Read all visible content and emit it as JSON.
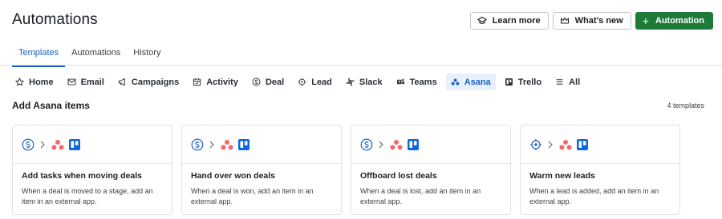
{
  "page": {
    "title": "Automations"
  },
  "header": {
    "learn_more_label": "Learn more",
    "whats_new_label": "What's new",
    "automation_label": "Automation"
  },
  "tabs": [
    {
      "label": "Templates",
      "active": true
    },
    {
      "label": "Automations",
      "active": false
    },
    {
      "label": "History",
      "active": false
    }
  ],
  "filters": [
    {
      "label": "Home",
      "icon": "star-icon"
    },
    {
      "label": "Email",
      "icon": "mail-icon"
    },
    {
      "label": "Campaigns",
      "icon": "megaphone-icon"
    },
    {
      "label": "Activity",
      "icon": "calendar-icon"
    },
    {
      "label": "Deal",
      "icon": "dollar-circle-icon"
    },
    {
      "label": "Lead",
      "icon": "target-icon"
    },
    {
      "label": "Slack",
      "icon": "slack-icon"
    },
    {
      "label": "Teams",
      "icon": "teams-icon"
    },
    {
      "label": "Asana",
      "icon": "asana-icon",
      "active": true
    },
    {
      "label": "Trello",
      "icon": "trello-icon"
    },
    {
      "label": "All",
      "icon": "list-icon"
    }
  ],
  "section": {
    "title": "Add Asana items",
    "count": "4 templates"
  },
  "cards": [
    {
      "title": "Add tasks when moving deals",
      "description": "When a deal is moved to a stage, add an item in an external app.",
      "trigger_icon": "dollar-circle-icon"
    },
    {
      "title": "Hand over won deals",
      "description": "When a deal is won, add an item in an external app.",
      "trigger_icon": "dollar-circle-icon"
    },
    {
      "title": "Offboard lost deals",
      "description": "When a deal is lost, add an item in an external app.",
      "trigger_icon": "dollar-circle-icon"
    },
    {
      "title": "Warm new leads",
      "description": "When a lead is added, add an item in an external app.",
      "trigger_icon": "target-icon"
    }
  ],
  "colors": {
    "accent": "#1a5fc7",
    "primary_button": "#1e7a39",
    "asana": "#f06a6a",
    "trello": "#0c66e4",
    "deal_icon": "#1a5fc7"
  }
}
